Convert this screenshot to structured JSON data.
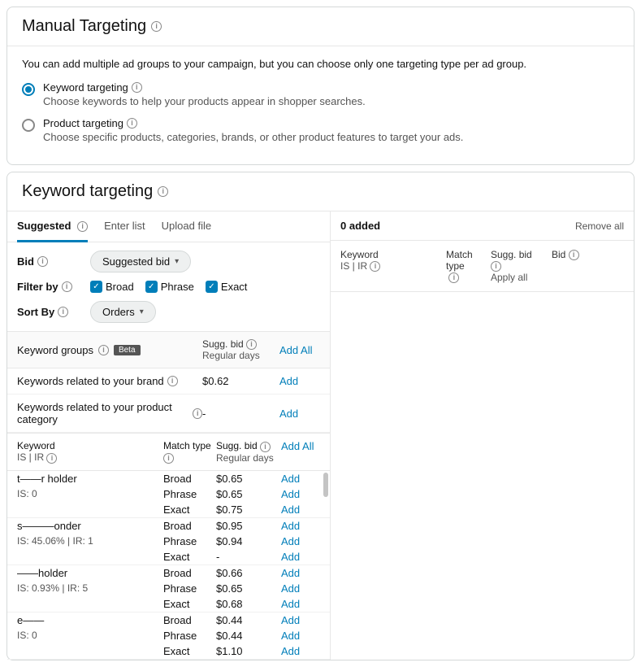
{
  "manualTargeting": {
    "title": "Manual Targeting",
    "desc": "You can add multiple ad groups to your campaign, but you can choose only one targeting type per ad group.",
    "keyword": {
      "label": "Keyword targeting",
      "sub": "Choose keywords to help your products appear in shopper searches."
    },
    "product": {
      "label": "Product targeting",
      "sub": "Choose specific products, categories, brands, or other product features to target your ads."
    }
  },
  "keywordTargeting": {
    "title": "Keyword targeting",
    "tabs": {
      "suggested": "Suggested",
      "enterList": "Enter list",
      "uploadFile": "Upload file"
    },
    "bid": {
      "label": "Bid",
      "value": "Suggested bid"
    },
    "filter": {
      "label": "Filter by",
      "broad": "Broad",
      "phrase": "Phrase",
      "exact": "Exact"
    },
    "sort": {
      "label": "Sort By",
      "value": "Orders"
    },
    "groupsHead": {
      "label": "Keyword groups",
      "beta": "Beta",
      "sugBid": "Sugg. bid",
      "regDays": "Regular days",
      "addAll": "Add All"
    },
    "groups": [
      {
        "name": "Keywords related to your brand",
        "bid": "$0.62",
        "action": "Add"
      },
      {
        "name": "Keywords related to your product category",
        "bid": "-",
        "action": "Add"
      }
    ],
    "kwHead": {
      "keyword": "Keyword",
      "isir": "IS | IR",
      "matchType": "Match type",
      "sugBid": "Sugg. bid",
      "regDays": "Regular days",
      "addAll": "Add All"
    },
    "kwRows": [
      {
        "name": "t——r holder",
        "meta": "IS: 0",
        "lines": [
          {
            "mt": "Broad",
            "bid": "$0.65",
            "act": "Add"
          },
          {
            "mt": "Phrase",
            "bid": "$0.65",
            "act": "Add"
          },
          {
            "mt": "Exact",
            "bid": "$0.75",
            "act": "Add"
          }
        ]
      },
      {
        "name": "s———onder",
        "meta": "IS: 45.06% | IR: 1",
        "lines": [
          {
            "mt": "Broad",
            "bid": "$0.95",
            "act": "Add"
          },
          {
            "mt": "Phrase",
            "bid": "$0.94",
            "act": "Add"
          },
          {
            "mt": "Exact",
            "bid": "-",
            "act": "Add"
          }
        ]
      },
      {
        "name": "——holder",
        "meta": "IS: 0.93% | IR: 5",
        "lines": [
          {
            "mt": "Broad",
            "bid": "$0.66",
            "act": "Add"
          },
          {
            "mt": "Phrase",
            "bid": "$0.65",
            "act": "Add"
          },
          {
            "mt": "Exact",
            "bid": "$0.68",
            "act": "Add"
          }
        ]
      },
      {
        "name": "e——",
        "meta": "IS: 0",
        "lines": [
          {
            "mt": "Broad",
            "bid": "$0.44",
            "act": "Add"
          },
          {
            "mt": "Phrase",
            "bid": "$0.44",
            "act": "Add"
          },
          {
            "mt": "Exact",
            "bid": "$1.10",
            "act": "Add"
          }
        ]
      }
    ]
  },
  "right": {
    "added": "0 added",
    "removeAll": "Remove all",
    "cols": {
      "keyword": "Keyword",
      "isir": "IS | IR",
      "matchType": "Match type",
      "sugBid": "Sugg. bid",
      "applyAll": "Apply all",
      "bid": "Bid"
    }
  }
}
